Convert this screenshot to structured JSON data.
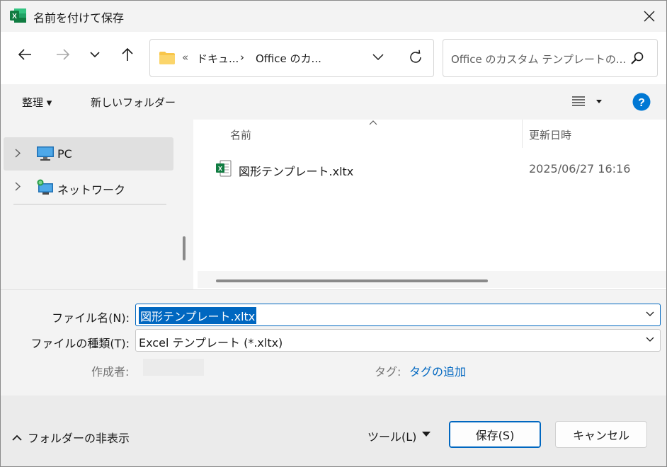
{
  "window": {
    "title": "名前を付けて保存"
  },
  "nav": {
    "back_icon": "arrow-left-icon",
    "forward_icon": "arrow-right-icon",
    "recent_icon": "chevron-down-icon",
    "up_icon": "arrow-up-icon",
    "address": {
      "overflow": "«",
      "segment1": "ドキュ...",
      "separator": "›",
      "segment2": "Office のカ..."
    },
    "search_placeholder": "Office のカスタム テンプレートの..."
  },
  "commandbar": {
    "organize": "整理 ▾",
    "new_folder": "新しいフォルダー"
  },
  "navpane": {
    "items": [
      {
        "label": "PC",
        "icon": "pc-icon",
        "selected": true
      },
      {
        "label": "ネットワーク",
        "icon": "network-icon",
        "selected": false
      }
    ]
  },
  "filelist": {
    "columns": {
      "name": "名前",
      "modified": "更新日時"
    },
    "files": [
      {
        "name": "図形テンプレート.xltx",
        "modified": "2025/06/27 16:16",
        "icon": "excel-template-icon"
      }
    ]
  },
  "form": {
    "filename_label": "ファイル名(N):",
    "filename_value": "図形テンプレート.xltx",
    "filetype_label": "ファイルの種類(T):",
    "filetype_value": "Excel テンプレート (*.xltx)",
    "author_label": "作成者:",
    "tags_label": "タグ:",
    "tags_link": "タグの追加"
  },
  "footer": {
    "hide_folders": "フォルダーの非表示",
    "tools": "ツール(L)",
    "save": "保存(S)",
    "cancel": "キャンセル"
  },
  "colors": {
    "accent": "#0067c0",
    "excel_green": "#107c41",
    "folder_yellow": "#f8c64b",
    "help_blue": "#0078d4"
  }
}
